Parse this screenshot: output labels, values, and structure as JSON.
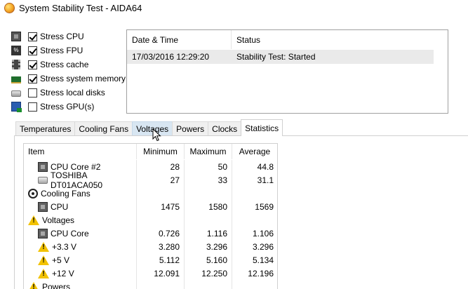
{
  "window": {
    "title": "System Stability Test - AIDA64"
  },
  "stress_options": [
    {
      "label": "Stress CPU",
      "checked": true,
      "icon": "cpu-icon"
    },
    {
      "label": "Stress FPU",
      "checked": true,
      "icon": "fpu-icon"
    },
    {
      "label": "Stress cache",
      "checked": true,
      "icon": "cache-icon"
    },
    {
      "label": "Stress system memory",
      "checked": true,
      "icon": "memory-icon"
    },
    {
      "label": "Stress local disks",
      "checked": false,
      "icon": "disk-icon"
    },
    {
      "label": "Stress GPU(s)",
      "checked": false,
      "icon": "gpu-icon"
    }
  ],
  "log": {
    "headers": {
      "datetime": "Date & Time",
      "status": "Status"
    },
    "rows": [
      {
        "datetime": "17/03/2016 12:29:20",
        "status": "Stability Test: Started"
      }
    ]
  },
  "tabs": [
    {
      "label": "Temperatures"
    },
    {
      "label": "Cooling Fans"
    },
    {
      "label": "Voltages",
      "hover": true
    },
    {
      "label": "Powers"
    },
    {
      "label": "Clocks"
    },
    {
      "label": "Statistics",
      "active": true
    }
  ],
  "stats": {
    "headers": {
      "item": "Item",
      "min": "Minimum",
      "max": "Maximum",
      "avg": "Average"
    },
    "rows": [
      {
        "type": "item",
        "icon": "chip",
        "label": "CPU Core #2",
        "min": "28",
        "max": "50",
        "avg": "44.8"
      },
      {
        "type": "item",
        "icon": "disk",
        "label": "TOSHIBA DT01ACA050",
        "min": "27",
        "max": "33",
        "avg": "31.1"
      },
      {
        "type": "group",
        "icon": "fan",
        "label": "Cooling Fans"
      },
      {
        "type": "item",
        "icon": "chip",
        "label": "CPU",
        "min": "1475",
        "max": "1580",
        "avg": "1569"
      },
      {
        "type": "group",
        "icon": "warn",
        "label": "Voltages"
      },
      {
        "type": "item",
        "icon": "chip",
        "label": "CPU Core",
        "min": "0.726",
        "max": "1.116",
        "avg": "1.106"
      },
      {
        "type": "item",
        "icon": "warn",
        "label": "+3.3 V",
        "min": "3.280",
        "max": "3.296",
        "avg": "3.296"
      },
      {
        "type": "item",
        "icon": "warn",
        "label": "+5 V",
        "min": "5.112",
        "max": "5.160",
        "avg": "5.134"
      },
      {
        "type": "item",
        "icon": "warn",
        "label": "+12 V",
        "min": "12.091",
        "max": "12.250",
        "avg": "12.196"
      },
      {
        "type": "group",
        "icon": "warn",
        "label": "Powers"
      }
    ]
  }
}
